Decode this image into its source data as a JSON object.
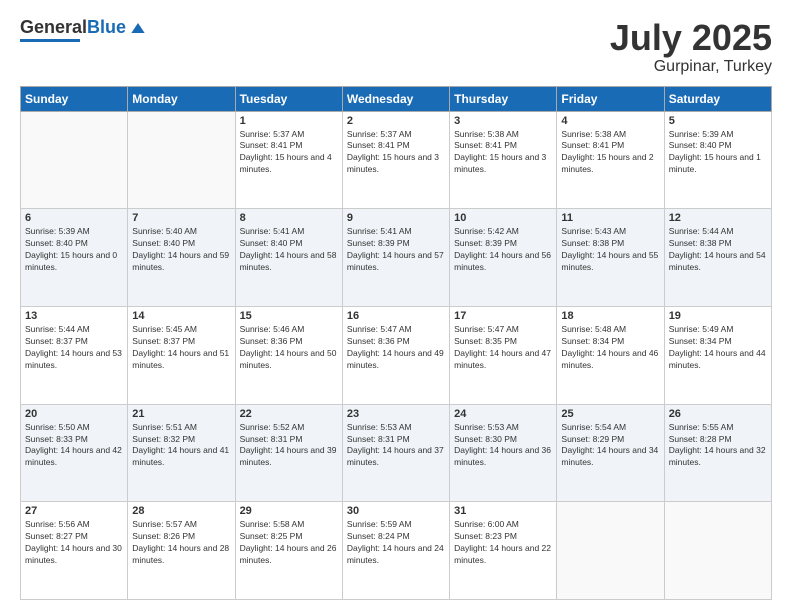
{
  "header": {
    "logo_general": "General",
    "logo_blue": "Blue",
    "month": "July 2025",
    "location": "Gurpinar, Turkey"
  },
  "weekdays": [
    "Sunday",
    "Monday",
    "Tuesday",
    "Wednesday",
    "Thursday",
    "Friday",
    "Saturday"
  ],
  "weeks": [
    [
      {
        "day": "",
        "sunrise": "",
        "sunset": "",
        "daylight": ""
      },
      {
        "day": "",
        "sunrise": "",
        "sunset": "",
        "daylight": ""
      },
      {
        "day": "1",
        "sunrise": "Sunrise: 5:37 AM",
        "sunset": "Sunset: 8:41 PM",
        "daylight": "Daylight: 15 hours and 4 minutes."
      },
      {
        "day": "2",
        "sunrise": "Sunrise: 5:37 AM",
        "sunset": "Sunset: 8:41 PM",
        "daylight": "Daylight: 15 hours and 3 minutes."
      },
      {
        "day": "3",
        "sunrise": "Sunrise: 5:38 AM",
        "sunset": "Sunset: 8:41 PM",
        "daylight": "Daylight: 15 hours and 3 minutes."
      },
      {
        "day": "4",
        "sunrise": "Sunrise: 5:38 AM",
        "sunset": "Sunset: 8:41 PM",
        "daylight": "Daylight: 15 hours and 2 minutes."
      },
      {
        "day": "5",
        "sunrise": "Sunrise: 5:39 AM",
        "sunset": "Sunset: 8:40 PM",
        "daylight": "Daylight: 15 hours and 1 minute."
      }
    ],
    [
      {
        "day": "6",
        "sunrise": "Sunrise: 5:39 AM",
        "sunset": "Sunset: 8:40 PM",
        "daylight": "Daylight: 15 hours and 0 minutes."
      },
      {
        "day": "7",
        "sunrise": "Sunrise: 5:40 AM",
        "sunset": "Sunset: 8:40 PM",
        "daylight": "Daylight: 14 hours and 59 minutes."
      },
      {
        "day": "8",
        "sunrise": "Sunrise: 5:41 AM",
        "sunset": "Sunset: 8:40 PM",
        "daylight": "Daylight: 14 hours and 58 minutes."
      },
      {
        "day": "9",
        "sunrise": "Sunrise: 5:41 AM",
        "sunset": "Sunset: 8:39 PM",
        "daylight": "Daylight: 14 hours and 57 minutes."
      },
      {
        "day": "10",
        "sunrise": "Sunrise: 5:42 AM",
        "sunset": "Sunset: 8:39 PM",
        "daylight": "Daylight: 14 hours and 56 minutes."
      },
      {
        "day": "11",
        "sunrise": "Sunrise: 5:43 AM",
        "sunset": "Sunset: 8:38 PM",
        "daylight": "Daylight: 14 hours and 55 minutes."
      },
      {
        "day": "12",
        "sunrise": "Sunrise: 5:44 AM",
        "sunset": "Sunset: 8:38 PM",
        "daylight": "Daylight: 14 hours and 54 minutes."
      }
    ],
    [
      {
        "day": "13",
        "sunrise": "Sunrise: 5:44 AM",
        "sunset": "Sunset: 8:37 PM",
        "daylight": "Daylight: 14 hours and 53 minutes."
      },
      {
        "day": "14",
        "sunrise": "Sunrise: 5:45 AM",
        "sunset": "Sunset: 8:37 PM",
        "daylight": "Daylight: 14 hours and 51 minutes."
      },
      {
        "day": "15",
        "sunrise": "Sunrise: 5:46 AM",
        "sunset": "Sunset: 8:36 PM",
        "daylight": "Daylight: 14 hours and 50 minutes."
      },
      {
        "day": "16",
        "sunrise": "Sunrise: 5:47 AM",
        "sunset": "Sunset: 8:36 PM",
        "daylight": "Daylight: 14 hours and 49 minutes."
      },
      {
        "day": "17",
        "sunrise": "Sunrise: 5:47 AM",
        "sunset": "Sunset: 8:35 PM",
        "daylight": "Daylight: 14 hours and 47 minutes."
      },
      {
        "day": "18",
        "sunrise": "Sunrise: 5:48 AM",
        "sunset": "Sunset: 8:34 PM",
        "daylight": "Daylight: 14 hours and 46 minutes."
      },
      {
        "day": "19",
        "sunrise": "Sunrise: 5:49 AM",
        "sunset": "Sunset: 8:34 PM",
        "daylight": "Daylight: 14 hours and 44 minutes."
      }
    ],
    [
      {
        "day": "20",
        "sunrise": "Sunrise: 5:50 AM",
        "sunset": "Sunset: 8:33 PM",
        "daylight": "Daylight: 14 hours and 42 minutes."
      },
      {
        "day": "21",
        "sunrise": "Sunrise: 5:51 AM",
        "sunset": "Sunset: 8:32 PM",
        "daylight": "Daylight: 14 hours and 41 minutes."
      },
      {
        "day": "22",
        "sunrise": "Sunrise: 5:52 AM",
        "sunset": "Sunset: 8:31 PM",
        "daylight": "Daylight: 14 hours and 39 minutes."
      },
      {
        "day": "23",
        "sunrise": "Sunrise: 5:53 AM",
        "sunset": "Sunset: 8:31 PM",
        "daylight": "Daylight: 14 hours and 37 minutes."
      },
      {
        "day": "24",
        "sunrise": "Sunrise: 5:53 AM",
        "sunset": "Sunset: 8:30 PM",
        "daylight": "Daylight: 14 hours and 36 minutes."
      },
      {
        "day": "25",
        "sunrise": "Sunrise: 5:54 AM",
        "sunset": "Sunset: 8:29 PM",
        "daylight": "Daylight: 14 hours and 34 minutes."
      },
      {
        "day": "26",
        "sunrise": "Sunrise: 5:55 AM",
        "sunset": "Sunset: 8:28 PM",
        "daylight": "Daylight: 14 hours and 32 minutes."
      }
    ],
    [
      {
        "day": "27",
        "sunrise": "Sunrise: 5:56 AM",
        "sunset": "Sunset: 8:27 PM",
        "daylight": "Daylight: 14 hours and 30 minutes."
      },
      {
        "day": "28",
        "sunrise": "Sunrise: 5:57 AM",
        "sunset": "Sunset: 8:26 PM",
        "daylight": "Daylight: 14 hours and 28 minutes."
      },
      {
        "day": "29",
        "sunrise": "Sunrise: 5:58 AM",
        "sunset": "Sunset: 8:25 PM",
        "daylight": "Daylight: 14 hours and 26 minutes."
      },
      {
        "day": "30",
        "sunrise": "Sunrise: 5:59 AM",
        "sunset": "Sunset: 8:24 PM",
        "daylight": "Daylight: 14 hours and 24 minutes."
      },
      {
        "day": "31",
        "sunrise": "Sunrise: 6:00 AM",
        "sunset": "Sunset: 8:23 PM",
        "daylight": "Daylight: 14 hours and 22 minutes."
      },
      {
        "day": "",
        "sunrise": "",
        "sunset": "",
        "daylight": ""
      },
      {
        "day": "",
        "sunrise": "",
        "sunset": "",
        "daylight": ""
      }
    ]
  ]
}
